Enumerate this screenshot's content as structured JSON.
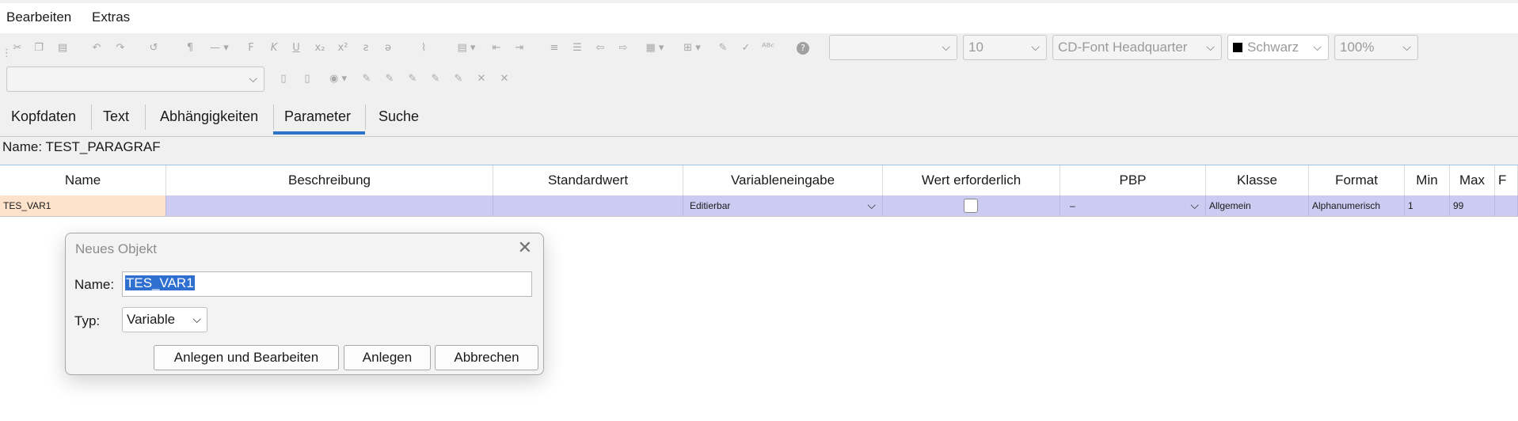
{
  "menu": {
    "items": [
      "Bearbeiten",
      "Extras"
    ]
  },
  "toolbar": {
    "font_size": "10",
    "font_name": "CD-Font Headquarter",
    "color_name": "Schwarz",
    "zoom": "100%"
  },
  "tabs": [
    "Kopfdaten",
    "Text",
    "Abhängigkeiten",
    "Parameter",
    "Suche"
  ],
  "name_line": "Name: TEST_PARAGRAF",
  "table": {
    "headers": [
      "Name",
      "Beschreibung",
      "Standardwert",
      "Variableneingabe",
      "Wert erforderlich",
      "PBP",
      "Klasse",
      "Format",
      "Min",
      "Max",
      "F"
    ],
    "row": {
      "name": "TES_VAR1",
      "beschreibung": "",
      "standardwert": "",
      "variableneingabe": "Editierbar",
      "pbp": "–",
      "klasse": "Allgemein",
      "format": "Alphanumerisch",
      "min": "1",
      "max": "99"
    }
  },
  "dialog": {
    "title": "Neues Objekt",
    "name_label": "Name:",
    "name_value": "TES_VAR1",
    "type_label": "Typ:",
    "type_value": "Variable",
    "buttons": [
      "Anlegen und Bearbeiten",
      "Anlegen",
      "Abbrechen"
    ]
  }
}
